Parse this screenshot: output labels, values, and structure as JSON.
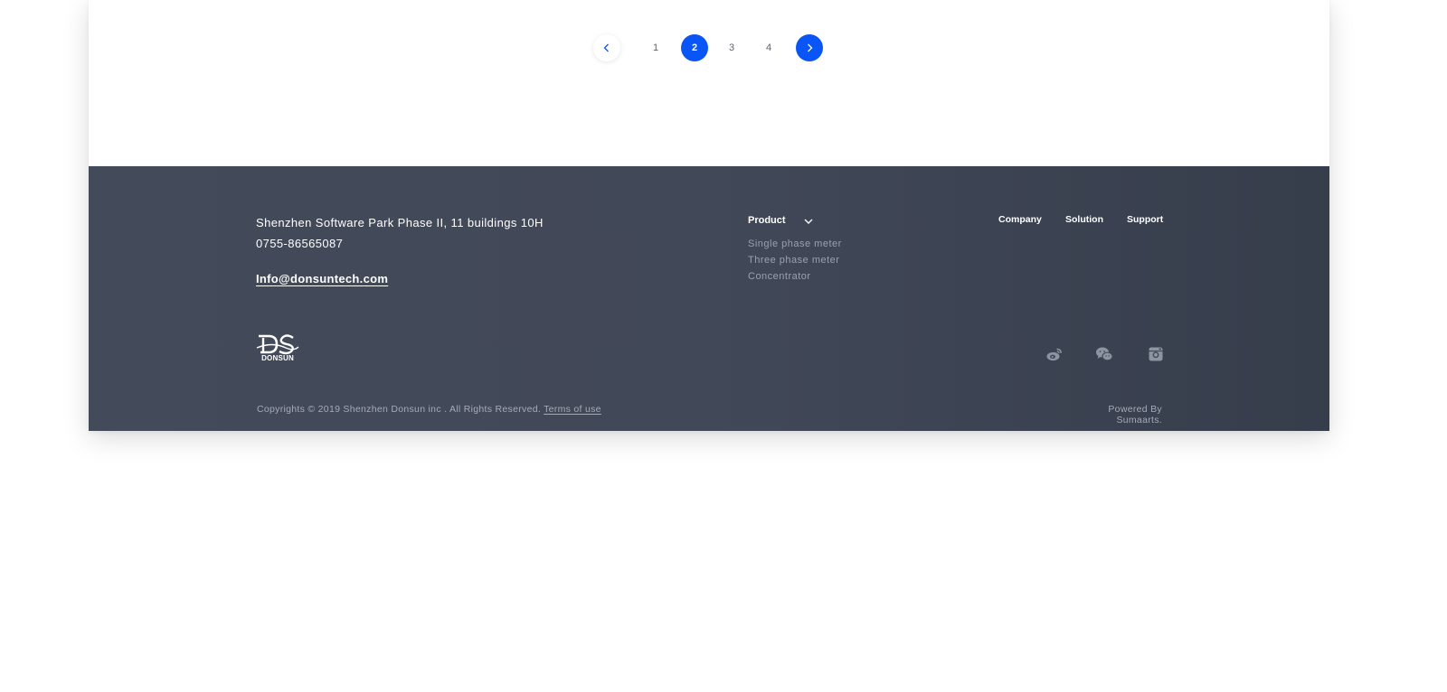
{
  "pagination": {
    "prev_icon": "chevron-left-icon",
    "next_icon": "chevron-right-icon",
    "pages": [
      "1",
      "2",
      "3",
      "4"
    ],
    "current_page": "2",
    "accent_color": "#0a55f5"
  },
  "footer": {
    "address_line1": "Shenzhen Software Park Phase II, 11 buildings 10H",
    "phone": "0755-86565087",
    "email": "Info@donsuntech.com",
    "logo_text": "DONSUN",
    "nav": {
      "product_label": "Product",
      "product_items": [
        "Single phase meter",
        "Three phase meter",
        "Concentrator"
      ],
      "company_label": "Company",
      "solution_label": "Solution",
      "support_label": "Support"
    },
    "social_icons": [
      "weibo-icon",
      "wechat-icon",
      "instagram-icon"
    ],
    "copyright": "Copyrights © 2019 Shenzhen Donsun inc  . All Rights Reserved.",
    "terms_label": "Terms of use",
    "powered_by": "Powered By Sumaarts.",
    "background_color": "#414858"
  }
}
